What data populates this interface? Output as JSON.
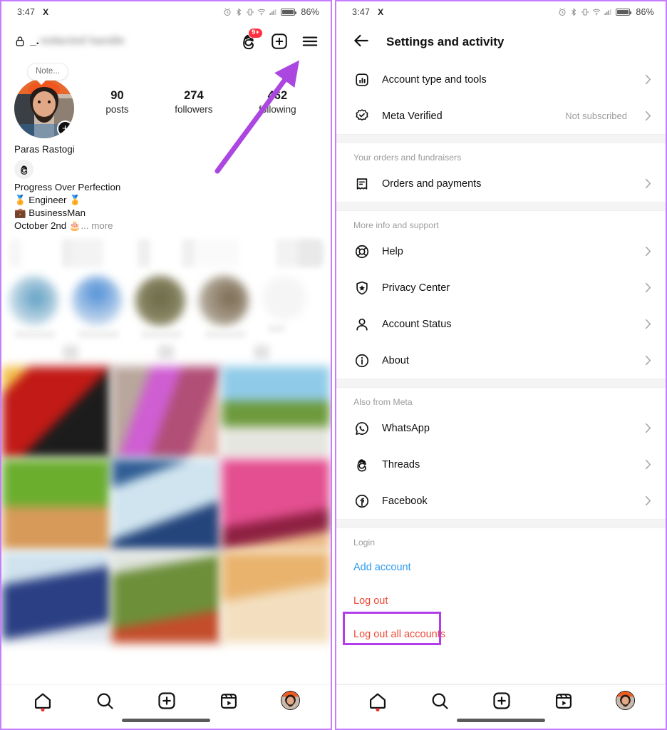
{
  "statusbar": {
    "time": "3:47",
    "app_logo": "X",
    "battery_pct": "86%",
    "icons": [
      "alarm-icon",
      "bluetooth-icon",
      "vibrate-icon",
      "wifi-icon",
      "signal-icon",
      "battery-icon"
    ]
  },
  "left_panel": {
    "header": {
      "lock_icon": "lock-icon",
      "username_visible": "_.",
      "username_blurred": "redacted handle",
      "threads_icon": "threads-icon",
      "threads_badge": "9+",
      "create_icon": "plus-square-icon",
      "menu_icon": "hamburger-menu-icon"
    },
    "profile": {
      "note_bubble": "Note...",
      "avatar_add_icon": "plus-circle-icon",
      "full_name": "Paras Rastogi",
      "threads_chip_icon": "threads-icon",
      "stats": [
        {
          "count": "90",
          "label": "posts"
        },
        {
          "count": "274",
          "label": "followers"
        },
        {
          "count": "462",
          "label": "following"
        }
      ],
      "bio_lines": [
        "Progress Over Perfection",
        "🏅 Engineer 🏅",
        "💼 BusinessMan",
        "October 2nd 🎂"
      ],
      "more_label": "... more"
    },
    "grid_colors": [
      "#c21a16",
      "#b86fb5",
      "#8fc4e3",
      "#6ba32e",
      "#2f5d94",
      "#e34f90",
      "#2b3f84",
      "#6d8f3a",
      "#e8b96a"
    ],
    "highlight_colors": [
      "#5f9fc4",
      "#4f8fd6",
      "#6b6a45",
      "#7a6a50"
    ],
    "annotation": {
      "arrow_color": "#ab47e0",
      "points_to": "hamburger-menu-icon"
    }
  },
  "right_panel": {
    "header": {
      "back_icon": "back-arrow-icon",
      "title": "Settings and activity"
    },
    "sections": [
      {
        "label": "",
        "items": [
          {
            "icon": "chart-square-icon",
            "label": "Account type and tools",
            "value": "",
            "chevron": true
          },
          {
            "icon": "meta-verified-badge-icon",
            "label": "Meta Verified",
            "value": "Not subscribed",
            "chevron": true
          }
        ]
      },
      {
        "label": "Your orders and fundraisers",
        "items": [
          {
            "icon": "receipt-icon",
            "label": "Orders and payments",
            "value": "",
            "chevron": true
          }
        ]
      },
      {
        "label": "More info and support",
        "items": [
          {
            "icon": "lifebuoy-help-icon",
            "label": "Help",
            "value": "",
            "chevron": true
          },
          {
            "icon": "shield-star-icon",
            "label": "Privacy Center",
            "value": "",
            "chevron": true
          },
          {
            "icon": "person-icon",
            "label": "Account Status",
            "value": "",
            "chevron": true
          },
          {
            "icon": "info-circle-icon",
            "label": "About",
            "value": "",
            "chevron": true
          }
        ]
      },
      {
        "label": "Also from Meta",
        "items": [
          {
            "icon": "whatsapp-icon",
            "label": "WhatsApp",
            "value": "",
            "chevron": true
          },
          {
            "icon": "threads-icon",
            "label": "Threads",
            "value": "",
            "chevron": true
          },
          {
            "icon": "facebook-icon",
            "label": "Facebook",
            "value": "",
            "chevron": true
          }
        ]
      }
    ],
    "login_section": {
      "label": "Login",
      "add_account": "Add account",
      "log_out": "Log out",
      "log_out_all": "Log out all accounts"
    },
    "annotation": {
      "highlight_color": "#b33dea",
      "highlights": "log-out-row"
    }
  },
  "bottom_nav": {
    "items": [
      {
        "icon": "home-icon",
        "active": true,
        "dot": true
      },
      {
        "icon": "search-icon",
        "active": false,
        "dot": false
      },
      {
        "icon": "create-plus-icon",
        "active": false,
        "dot": false
      },
      {
        "icon": "reels-icon",
        "active": false,
        "dot": false
      },
      {
        "icon": "profile-avatar-icon",
        "active": false,
        "dot": false
      }
    ]
  },
  "theme": {
    "accent_purple": "#b33dea",
    "link_blue": "#2e9bf0",
    "danger_red": "#ed4b38",
    "badge_red": "#ff2f41"
  }
}
